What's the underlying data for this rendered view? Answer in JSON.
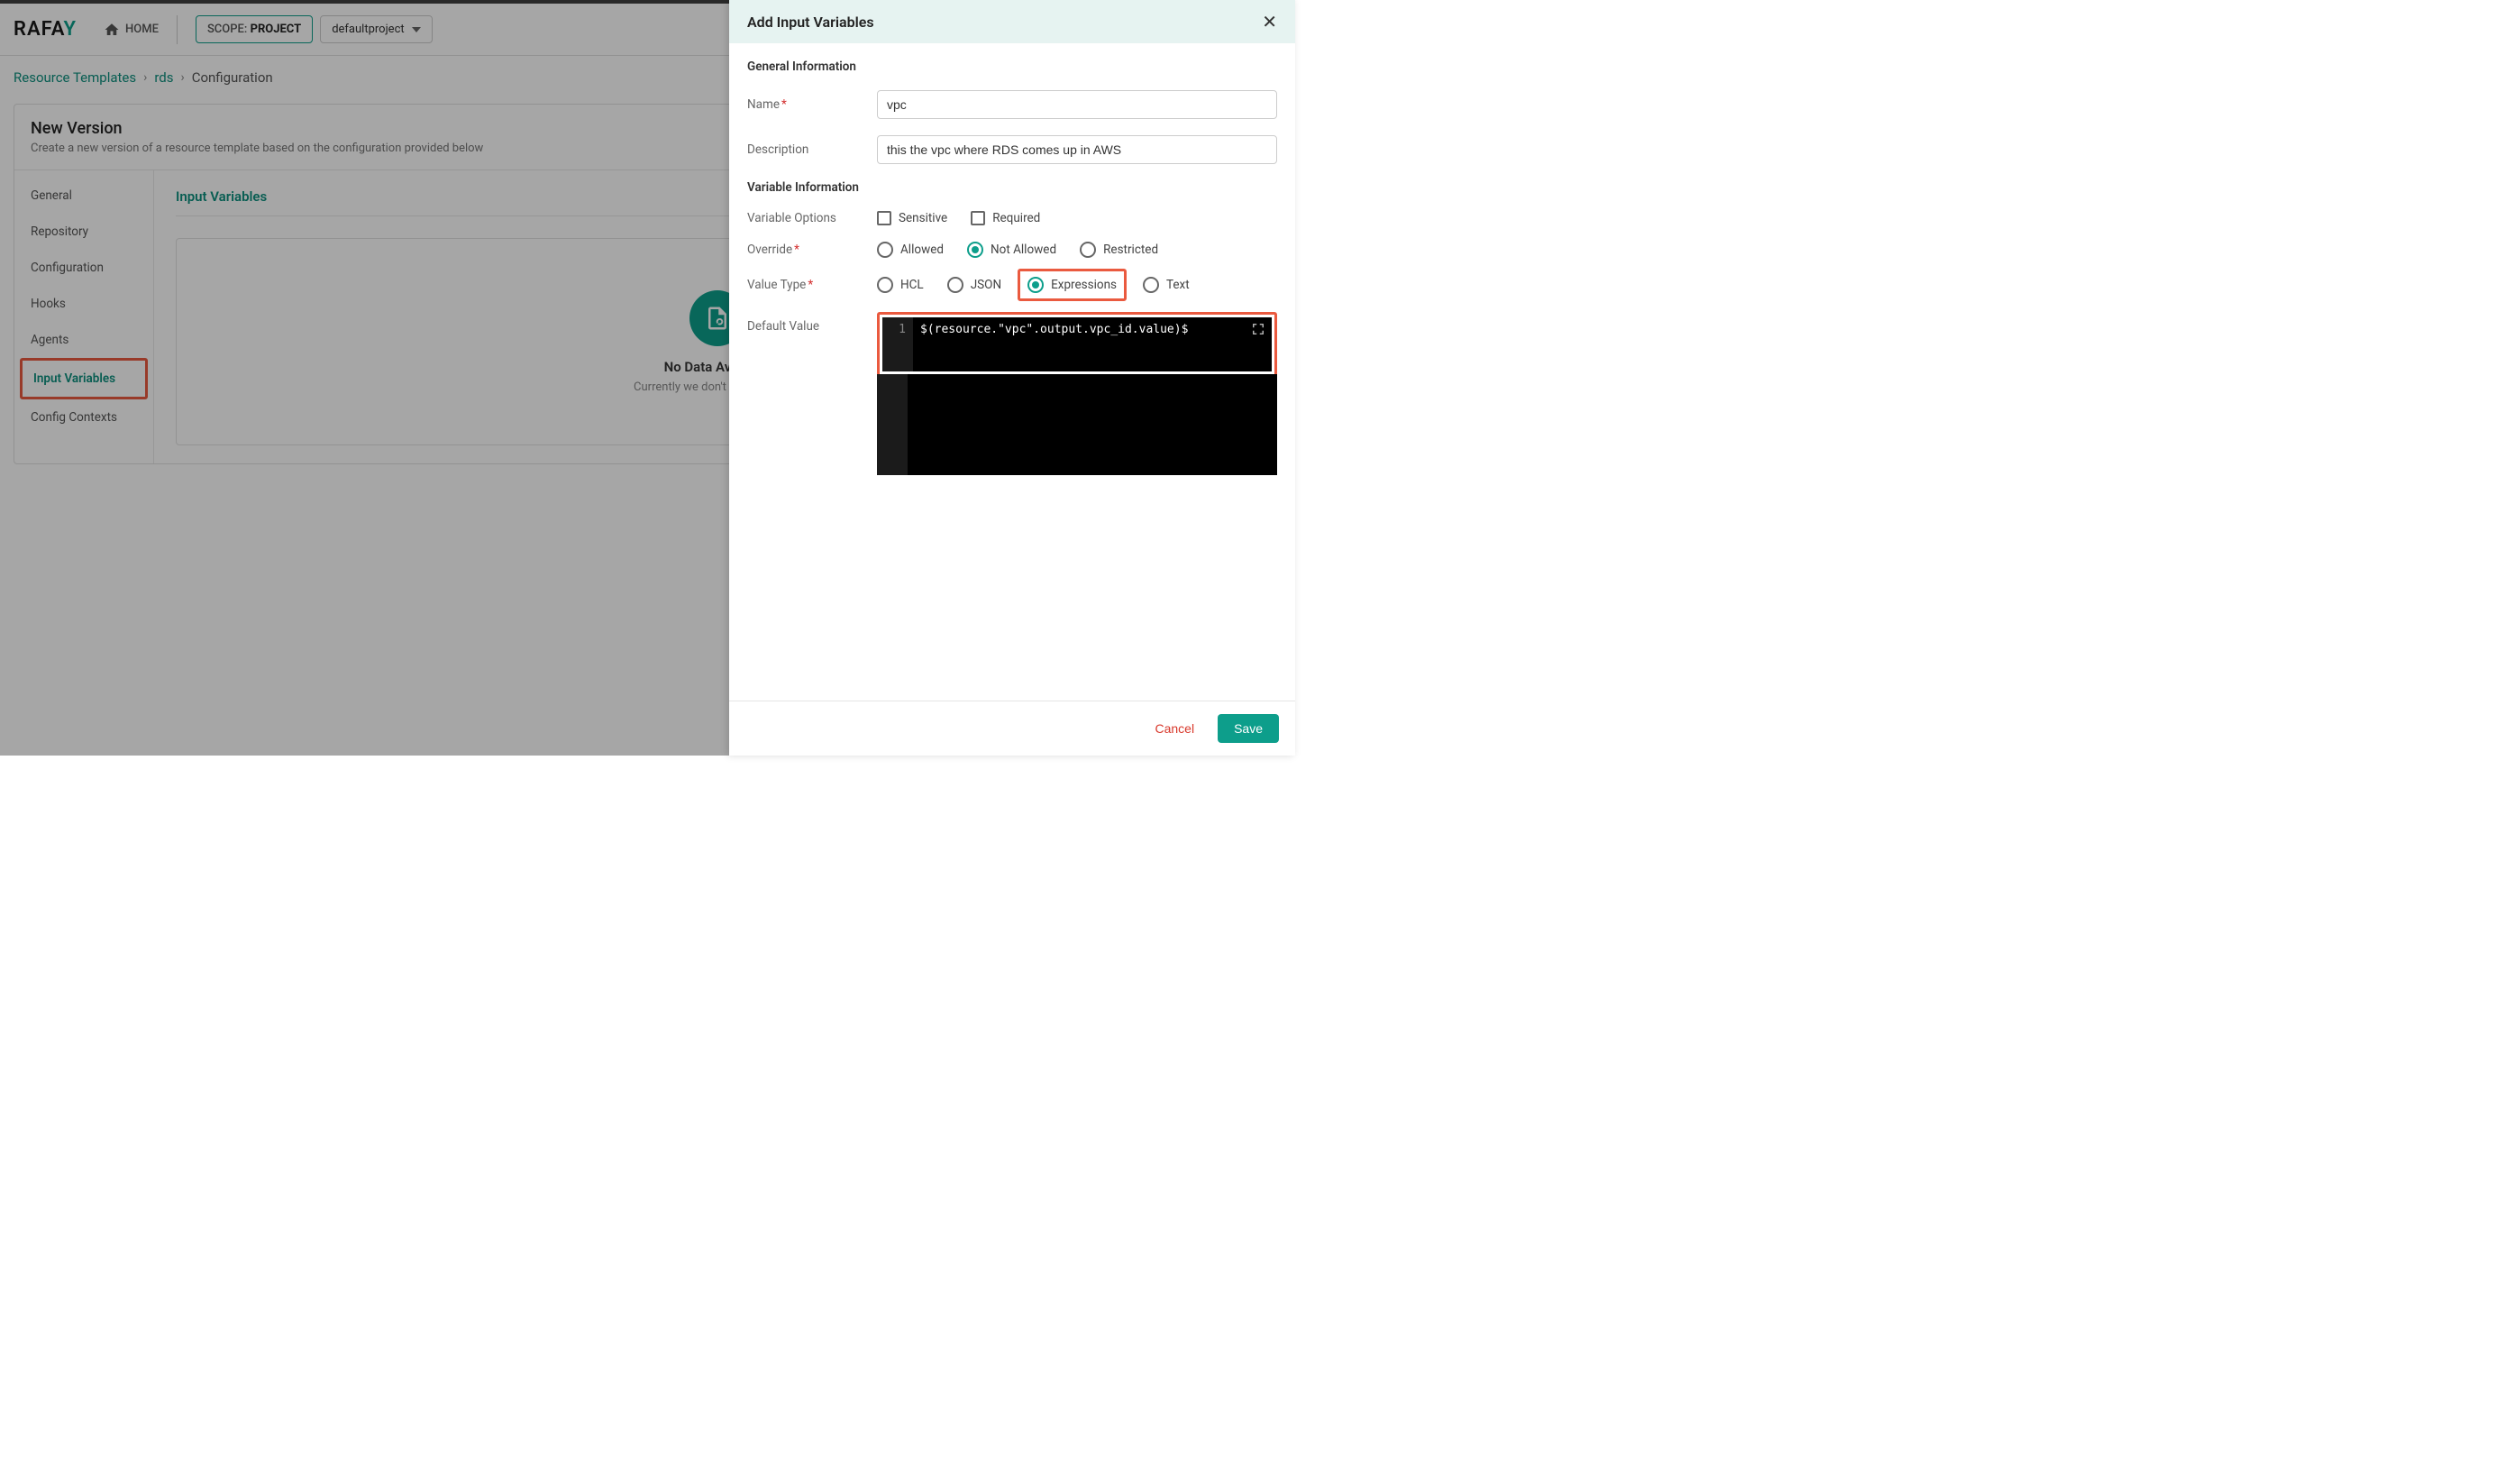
{
  "header": {
    "logo_main": "RAFA",
    "logo_accent": "Y",
    "home": "HOME",
    "scope_label": "SCOPE: ",
    "scope_value": "PROJECT",
    "project": "defaultproject"
  },
  "breadcrumb": {
    "items": [
      "Resource Templates",
      "rds"
    ],
    "current": "Configuration",
    "sep": "›"
  },
  "card": {
    "title": "New Version",
    "subtitle": "Create a new version of a resource template based on the configuration provided below"
  },
  "sidenav": {
    "items": [
      "General",
      "Repository",
      "Configuration",
      "Hooks",
      "Agents",
      "Input Variables",
      "Config Contexts"
    ],
    "active_index": 5
  },
  "content": {
    "heading": "Input Variables",
    "empty_title": "No Data Available",
    "empty_text": "Currently we don't have any data"
  },
  "drawer": {
    "title": "Add Input Variables",
    "section1": "General Information",
    "name_label": "Name",
    "name_value": "vpc",
    "desc_label": "Description",
    "desc_value": "this the vpc where RDS comes up in AWS",
    "section2": "Variable Information",
    "varopts_label": "Variable Options",
    "sensitive": "Sensitive",
    "required": "Required",
    "override_label": "Override",
    "override_opts": [
      "Allowed",
      "Not Allowed",
      "Restricted"
    ],
    "override_selected": 1,
    "vtype_label": "Value Type",
    "vtype_opts": [
      "HCL",
      "JSON",
      "Expressions",
      "Text"
    ],
    "vtype_selected": 2,
    "default_label": "Default Value",
    "code_line": "1",
    "code_text": "$(resource.\"vpc\".output.vpc_id.value)$",
    "cancel": "Cancel",
    "save": "Save"
  }
}
